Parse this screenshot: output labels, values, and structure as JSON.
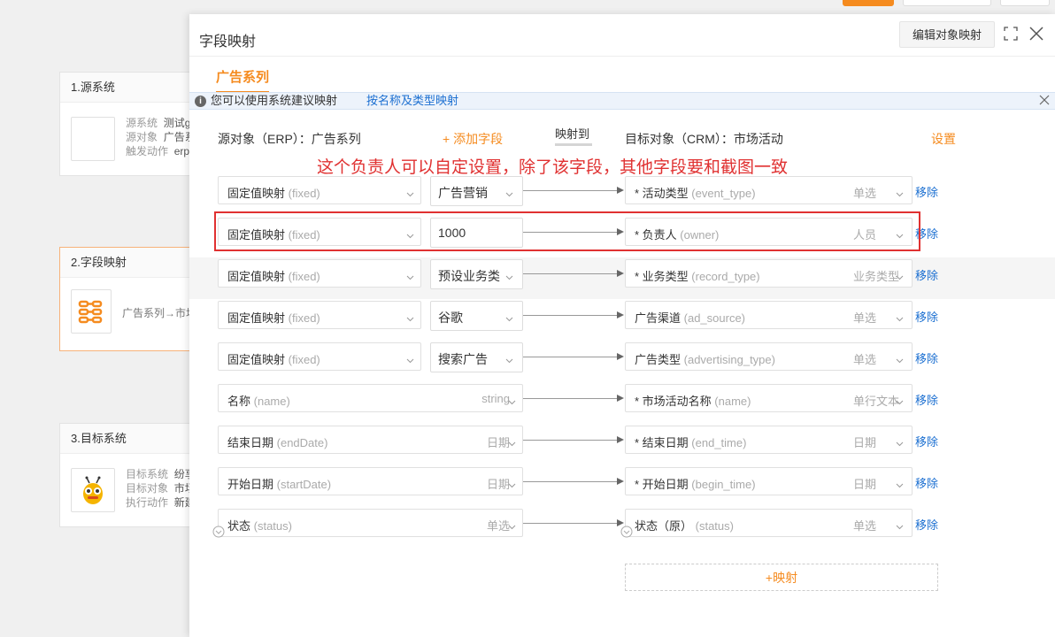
{
  "background": {
    "cards": [
      {
        "title": "1.源系统",
        "lines": [
          {
            "k": "源系统",
            "v": "测试g"
          },
          {
            "k": "源对象",
            "v": "广告系"
          },
          {
            "k": "触发动作",
            "v": "erpc"
          }
        ]
      },
      {
        "title": "2.字段映射",
        "summary": "广告系列→市场"
      },
      {
        "title": "3.目标系统",
        "lines": [
          {
            "k": "目标系统",
            "v": "纷享"
          },
          {
            "k": "目标对象",
            "v": "市场"
          },
          {
            "k": "执行动作",
            "v": "新建"
          }
        ]
      }
    ]
  },
  "panel": {
    "title": "字段映射",
    "edit_button": "编辑对象映射",
    "tab": "广告系列",
    "notice": {
      "text": "您可以使用系统建议映射",
      "link": "按名称及类型映射"
    },
    "source_header": "源对象（ERP）：广告系列",
    "add_field": "+ 添加字段",
    "map_to": "映射到",
    "target_header": "目标对象（CRM）：市场活动",
    "settings": "设置",
    "annotation": "这个负责人可以自定设置，除了该字段，其他字段要和截图一致",
    "remove_label": "移除",
    "add_mapping": "+映射"
  },
  "mappings": [
    {
      "src_cn": "固定值映射",
      "src_en": "(fixed)",
      "src_type": "",
      "value": "广告营销",
      "value_dropdown": true,
      "tgt_cn": "* 活动类型",
      "tgt_en": "(event_type)",
      "tgt_type": "单选"
    },
    {
      "src_cn": "固定值映射",
      "src_en": "(fixed)",
      "src_type": "",
      "value": "1000",
      "value_dropdown": false,
      "tgt_cn": "* 负责人",
      "tgt_en": "(owner)",
      "tgt_type": "人员"
    },
    {
      "src_cn": "固定值映射",
      "src_en": "(fixed)",
      "src_type": "",
      "value": "预设业务类型",
      "value_dropdown": true,
      "tgt_cn": "* 业务类型",
      "tgt_en": "(record_type)",
      "tgt_type": "业务类型"
    },
    {
      "src_cn": "固定值映射",
      "src_en": "(fixed)",
      "src_type": "",
      "value": "谷歌",
      "value_dropdown": true,
      "tgt_cn": "广告渠道",
      "tgt_en": "(ad_source)",
      "tgt_type": "单选"
    },
    {
      "src_cn": "固定值映射",
      "src_en": "(fixed)",
      "src_type": "",
      "value": "搜索广告",
      "value_dropdown": true,
      "tgt_cn": "广告类型",
      "tgt_en": "(advertising_type)",
      "tgt_type": "单选"
    },
    {
      "src_cn": "名称",
      "src_en": "(name)",
      "src_type": "string",
      "value": "",
      "value_dropdown": false,
      "tgt_cn": "* 市场活动名称",
      "tgt_en": "(name)",
      "tgt_type": "单行文本"
    },
    {
      "src_cn": "结束日期",
      "src_en": "(endDate)",
      "src_type": "日期",
      "value": "",
      "value_dropdown": false,
      "tgt_cn": "* 结束日期",
      "tgt_en": "(end_time)",
      "tgt_type": "日期"
    },
    {
      "src_cn": "开始日期",
      "src_en": "(startDate)",
      "src_type": "日期",
      "value": "",
      "value_dropdown": false,
      "tgt_cn": "* 开始日期",
      "tgt_en": "(begin_time)",
      "tgt_type": "日期"
    },
    {
      "src_cn": "状态",
      "src_en": "(status)",
      "src_type": "单选",
      "value": "",
      "value_dropdown": false,
      "tgt_cn": "状态（原）",
      "tgt_en": "(status)",
      "tgt_type": "单选"
    }
  ],
  "colors": {
    "accent": "#f58b1f",
    "link": "#1b6fd1",
    "annotation": "#e03131"
  }
}
